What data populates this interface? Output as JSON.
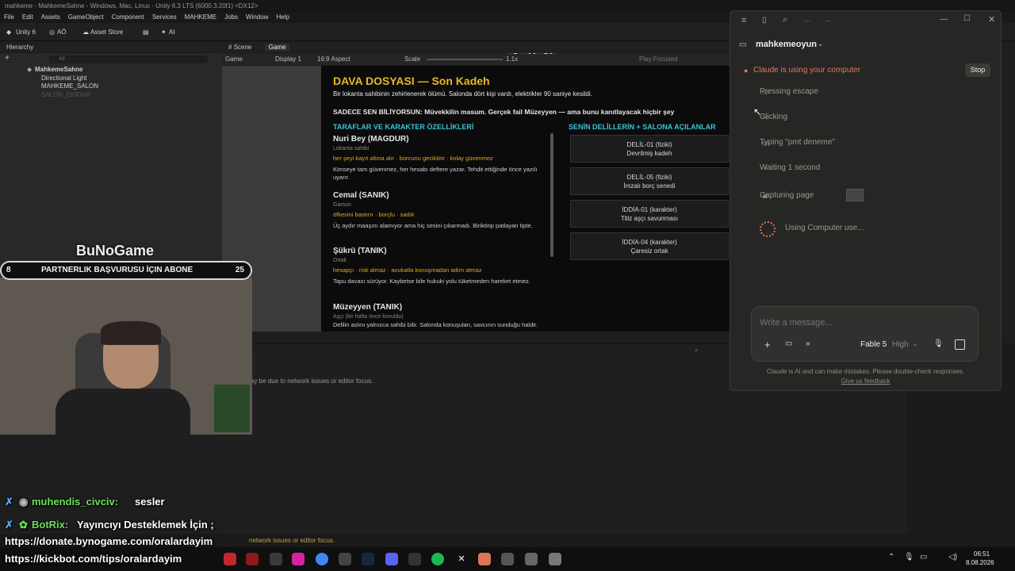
{
  "window_title": "mahkeme - MahkemeSahne - Windows, Mac, Linux - Unity 6.3 LTS (6000.3.20f1) <DX12>",
  "menu": [
    "File",
    "Edit",
    "Assets",
    "GameObject",
    "Component",
    "Services",
    "MAHKEME",
    "Jobs",
    "Window",
    "Help"
  ],
  "toolbar": {
    "unity": "Unity 6",
    "account": "AÖ",
    "asset_store": "Asset Store",
    "ai": "AI"
  },
  "hierarchy": {
    "title": "Hierarchy",
    "search_placeholder": "All",
    "scene": "MahkemeSahne",
    "items": [
      "Directional Light",
      "MAHKEME_SALON",
      "SALON_EKRANI"
    ]
  },
  "game_tabs": {
    "scene": "Scene",
    "game": "Game"
  },
  "game_bar": {
    "mode": "Game",
    "display": "Display 1",
    "aspect": "16:9 Aspect",
    "scale_label": "Scale",
    "scale_value": "1.1x",
    "play_focused": "Play Focused"
  },
  "dossier": {
    "title": "DAVA DOSYASI  —  Son Kadeh",
    "intro": "Bir lokanta sahibinin zehirlenerek ölümü. Salonda dört kişi vardı, elektrikler 90 saniye kesildi.",
    "secret": "SADECE SEN BİLİYORSUN: Müvekkilin masum. Gerçek fail Müzeyyen — ama bunu kanıtlayacak hiçbir şey",
    "parties_header": "TARAFLAR VE KARAKTER ÖZELLİKLERİ",
    "evidence_header": "SENİN DELİLLERİN + SALONA AÇILANLAR",
    "characters": [
      {
        "name": "Nuri Bey  (MAGDUR)",
        "role": "Lokanta sahibi",
        "tags": "her şeyi kayıt altına alır  ·  borcunu geciktirir  ·  kolay güvenmez",
        "desc": "Kimseye tam güvenmez, her hesabı deftere yazar. Tehdit ettiğinde önce yazılı uyarır."
      },
      {
        "name": "Cemal  (SANIK)",
        "role": "Garson",
        "tags": "öfkesini bastırır  ·  borçlu  ·  sadık",
        "desc": "Üç aydır maaşını alamıyor ama hiç sesini çıkarmadı. Biriktirip patlayan tipte."
      },
      {
        "name": "Şükrü  (TANIK)",
        "role": "Ortak",
        "tags": "hesapçı  ·  risk almaz  ·  avukatla konuşmadan adım atmaz",
        "desc": "Tapu davası sürüyor. Kaybetse bile hukuki yolu tüketmeden hareket etmez."
      },
      {
        "name": "Müzeyyen  (TANIK)",
        "role": "Aşçı (bir hafta önce kovuldu)",
        "tags": "",
        "desc": "Delilin aslını yalnızca sahibi bilir. Salonda konuşulan, savcının sunduğu haldir."
      }
    ],
    "evidence": [
      {
        "code": "DELİL-01  (fiziki)",
        "label": "Devrilmiş kadeh"
      },
      {
        "code": "DELİL-05  (fiziki)",
        "label": "İmzalı borç senedi"
      },
      {
        "code": "İDDİA-01  (karakter)",
        "label": "Titiz aşçı savunması"
      },
      {
        "code": "İDDİA-04  (karakter)",
        "label": "Çaresiz ortak"
      }
    ]
  },
  "console": {
    "message": "ay be due to network issues or editor focus."
  },
  "status_message": "network issues or editor focus.",
  "claude": {
    "project": "mahkemeoyun",
    "status": "Claude is using your computer",
    "stop": "Stop",
    "steps": [
      "Pressing escape",
      "Clicking",
      "Typing \"pmt deneme\"",
      "Waiting 1 second",
      "Capturing page"
    ],
    "working": "Using Computer use...",
    "input_placeholder": "Write a message...",
    "model": "Fable 5",
    "effort": "High",
    "disclaimer": "Claude is AI and can make mistakes. Please double-check responses.",
    "feedback": "Give us feedback"
  },
  "overlay": {
    "logo": "BuNoGame",
    "partner_left": "8",
    "partner_text": "PARTNERLIK BAŞVURUSU İÇIN ABONE",
    "partner_right": "25",
    "chat": [
      {
        "user": "muhendis_civciv:",
        "text": "sesler"
      },
      {
        "user": "BotRix:",
        "text": "Yayıncıyı Desteklemek İçin ;"
      }
    ],
    "link1": "https://donate.bynogame.com/oralardayim",
    "link2": "https://kickbot.com/tips/oralardayim"
  },
  "clock": {
    "time": "06:51",
    "date": "8.08.2026"
  },
  "colors": {
    "accent_gold": "#e8b829",
    "accent_cyan": "#39c3d8",
    "claude_status": "#e07a5f",
    "chat_green": "#6de05a"
  }
}
